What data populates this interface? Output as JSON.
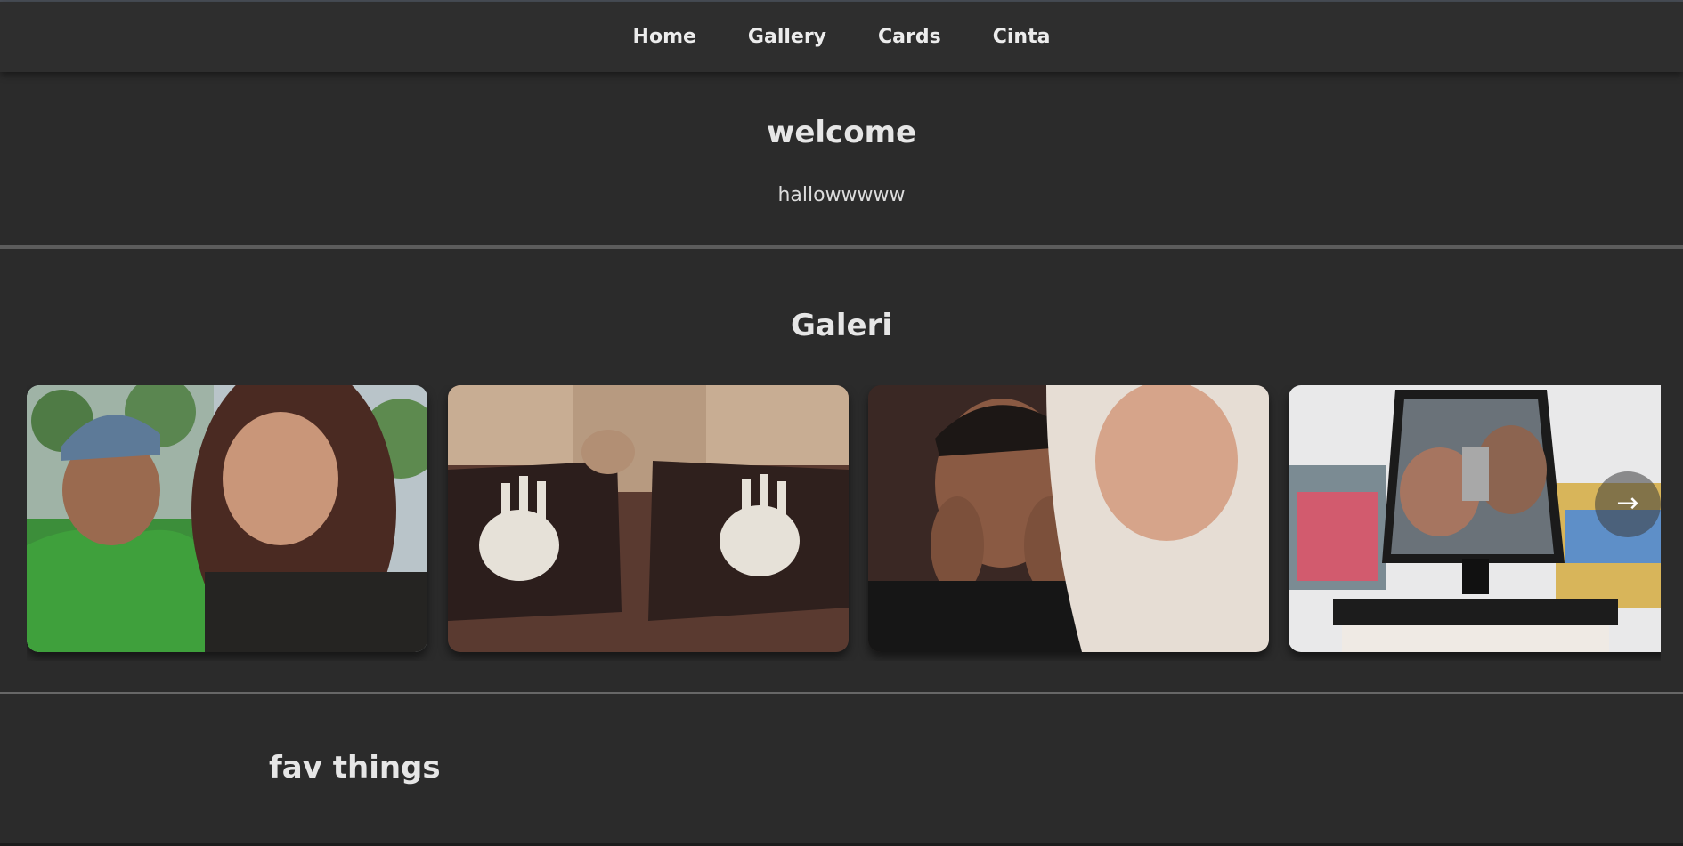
{
  "nav": {
    "items": [
      {
        "label": "Home"
      },
      {
        "label": "Gallery"
      },
      {
        "label": "Cards"
      },
      {
        "label": "Cinta"
      }
    ]
  },
  "welcome": {
    "title": "welcome",
    "text": "hallowwwww"
  },
  "gallery": {
    "title": "Galeri",
    "photos": [
      {
        "subject": "selfie-couple-outdoor"
      },
      {
        "subject": "handprint-paintings"
      },
      {
        "subject": "selfie-couple-indoor"
      },
      {
        "subject": "mirror-selfie-store"
      }
    ],
    "next_icon": "arrow-right-icon",
    "next_glyph": "→"
  },
  "fav": {
    "title": "fav things"
  },
  "colors": {
    "background": "#2b2b2b",
    "navbar": "#2e2e2e",
    "text": "#e6e6e6"
  }
}
